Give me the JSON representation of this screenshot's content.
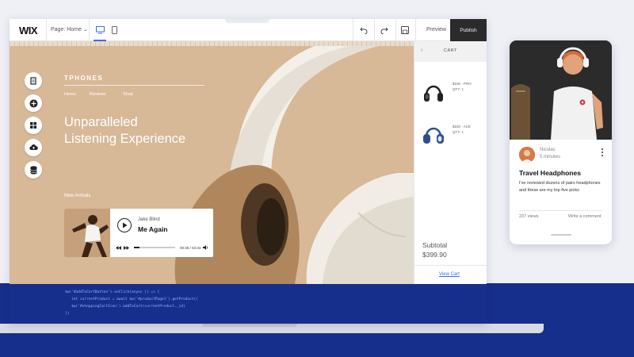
{
  "editor": {
    "logo": "WIX",
    "page_select": "Page: Home",
    "preview_label": "Preview",
    "publish_label": "Publish"
  },
  "site": {
    "brand": "TPHONES",
    "nav": [
      "Home",
      "Reviews",
      "Shop"
    ],
    "headline_1": "Unparalleled",
    "headline_2": "Listening Experience",
    "section_label": "New Arrivals"
  },
  "player": {
    "artist": "Jake Blind",
    "song": "Me Again",
    "time": "00:30 / 03:34",
    "progress": 0.14
  },
  "cart": {
    "title": "CART",
    "items": [
      {
        "price": "$150 - PRO",
        "qty": "QTY: 1"
      },
      {
        "price": "$150 - ACE",
        "qty": "QTY: 1"
      }
    ],
    "subtotal_label": "Subtotal",
    "subtotal_value": "$399.90",
    "view_cart": "View Cart"
  },
  "code": [
    "$w('#addToCartButton').onClick(async () => {",
    "   let currentProduct = await $w('#productPage1').getProduct()",
    "   $w('#shoppingCartIcon').addToCart(currentProduct._id)",
    "})"
  ],
  "phone": {
    "author": "Nicolas",
    "time": "5 minutes",
    "post_title": "Travel Headphones",
    "post_text": "I've reviewed dozens of pairs headphones and these are my top five picks",
    "views": "237 views",
    "comment": "Write a comment"
  },
  "colors": {
    "canvas": "#d7b897",
    "band": "#172f8c",
    "accent": "#3b6df0"
  }
}
